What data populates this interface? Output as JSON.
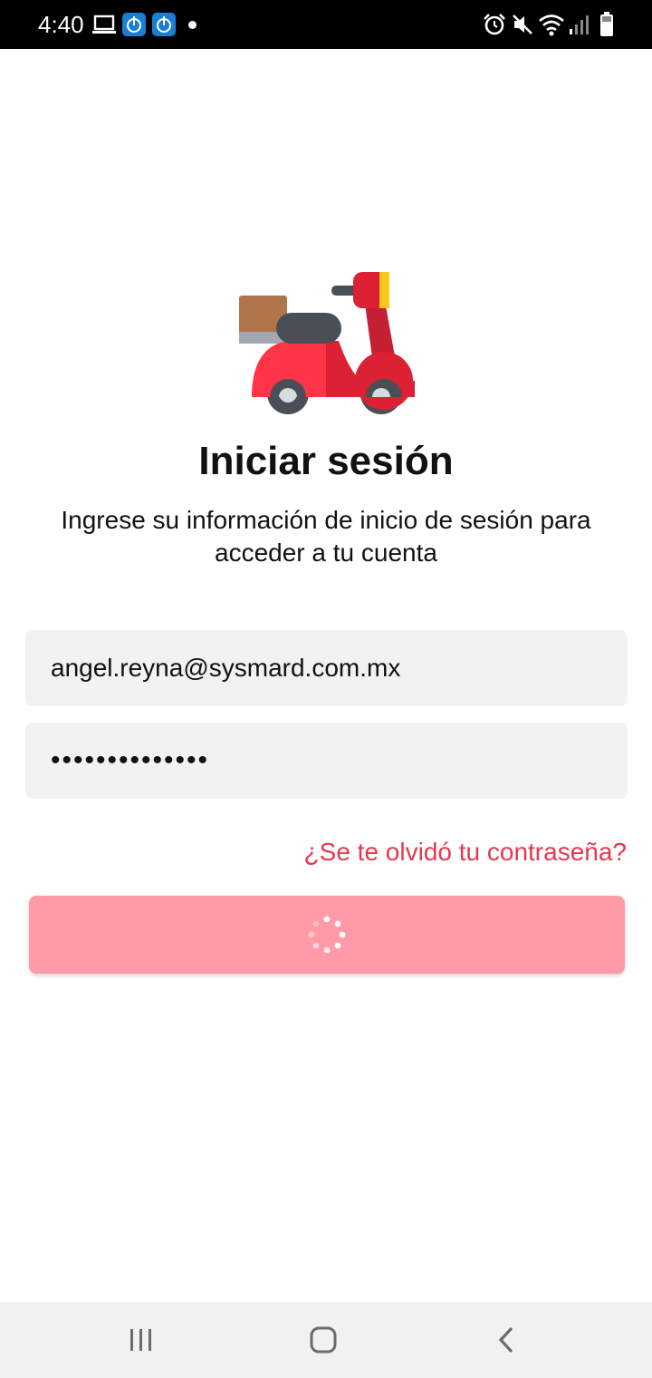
{
  "status_bar": {
    "time": "4:40",
    "icons": [
      "laptop-icon",
      "app-notification-icon",
      "app-notification-icon",
      "notification-dot",
      "alarm-icon",
      "mute-icon",
      "wifi-icon",
      "signal-icon",
      "battery-icon"
    ]
  },
  "login": {
    "title": "Iniciar sesión",
    "subtitle": "Ingrese su información de inicio de sesión para acceder a tu cuenta",
    "email_value": "angel.reyna@sysmard.com.mx",
    "password_value": "••••••••••••••",
    "forgot_password": "¿Se te olvidó tu contraseña?",
    "submit_state": "loading"
  },
  "colors": {
    "accent": "#e8384f",
    "button_loading": "#ff9aa6",
    "field_bg": "#f2f2f2"
  },
  "nav_bar": {
    "buttons": [
      "recent-apps-icon",
      "home-icon",
      "back-icon"
    ]
  }
}
